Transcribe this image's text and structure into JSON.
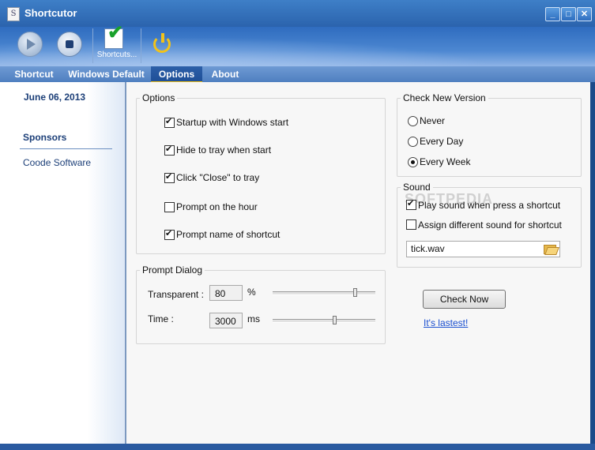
{
  "window": {
    "title": "Shortcutor",
    "app_icon_letter": "S",
    "minimize": "_",
    "maximize": "□",
    "close": "✕"
  },
  "toolbar": {
    "play_icon": "play-icon",
    "stop_icon": "stop-icon",
    "shortcuts_label": "Shortcuts...",
    "power_icon": "power-icon"
  },
  "tabs": [
    {
      "label": "Shortcut"
    },
    {
      "label": "Windows Default"
    },
    {
      "label": "Options",
      "active": true
    },
    {
      "label": "About"
    }
  ],
  "sidebar": {
    "date": "June 06, 2013",
    "sponsors": "Sponsors",
    "sponsor_link": "Coode Software"
  },
  "options": {
    "title": "Options",
    "items": [
      {
        "label": "Startup with Windows start",
        "checked": true
      },
      {
        "label": "Hide to tray when start",
        "checked": true
      },
      {
        "label": "Click \"Close\" to tray",
        "checked": true
      },
      {
        "label": "Prompt on the hour",
        "checked": false
      },
      {
        "label": "Prompt name of shortcut",
        "checked": true
      }
    ]
  },
  "prompt_dialog": {
    "title": "Prompt Dialog",
    "transparent_label": "Transparent :",
    "transparent_value": "80",
    "transparent_unit": "%",
    "transparent_slider_fraction": 0.8,
    "time_label": "Time :",
    "time_value": "3000",
    "time_unit": "ms",
    "time_slider_fraction": 0.6
  },
  "check_new_version": {
    "title": "Check New Version",
    "options": [
      {
        "label": "Never",
        "selected": false
      },
      {
        "label": "Every Day",
        "selected": false
      },
      {
        "label": "Every Week",
        "selected": true
      }
    ]
  },
  "sound": {
    "title": "Sound",
    "play_sound_label": "Play sound when press a shortcut",
    "play_sound_checked": true,
    "assign_label": "Assign different sound for shortcut",
    "assign_checked": false,
    "file_value": "tick.wav",
    "browse_icon": "folder-open-icon"
  },
  "update": {
    "check_now_label": "Check Now",
    "status_link": "It's lastest!"
  },
  "watermark": "SOFTPEDIA",
  "colors": {
    "title_bar": "#2b63ad",
    "tab_active": "#1e4e96",
    "accent_yellow": "#f1c21a",
    "link": "#1a4fd0"
  }
}
